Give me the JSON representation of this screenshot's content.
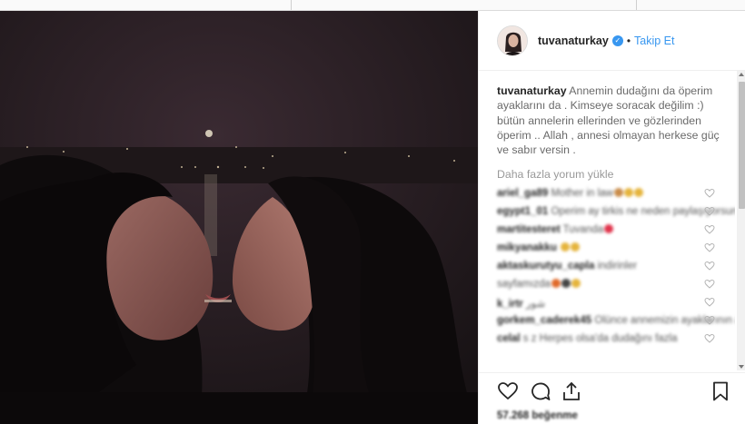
{
  "post": {
    "username": "tuvanaturkay",
    "dot": "•",
    "follow_label": "Takip Et",
    "caption": "Annemin dudağını da öperim ayaklarını da . Kimseye soracak değilim :) bütün annelerin ellerinden ve gözlerinden öperim .. Allah , annesi olmayan herkese güç ve sabır versin .",
    "load_more": "Daha fazla yorum yükle",
    "likes": "57.268 beğenme"
  },
  "comments": [
    {
      "user": "ariel_ga89",
      "text": "Mother in law",
      "emoji": [
        "#c98c4a",
        "#e5b43c",
        "#e5b43c"
      ]
    },
    {
      "user": "egypt1_01",
      "text": "Öperim ay tirkis ne neden paylaşıyorsun",
      "emoji": []
    },
    {
      "user": "martitesteret",
      "text": "Tuvanda",
      "emoji": [
        "#e0334b"
      ]
    },
    {
      "user": "mikyanakku",
      "text": "",
      "emoji": [
        "#e5b43c",
        "#e5b43c"
      ]
    },
    {
      "user": "aktaskurutyu_capla",
      "text": "indirinler",
      "emoji": []
    },
    {
      "user": "",
      "text": "sayfamızda",
      "emoji": [
        "#e06a2a",
        "#444",
        "#e5b43c"
      ]
    },
    {
      "user": "k_irtr",
      "text": "شور",
      "emoji": []
    },
    {
      "user": "gorkem_caderek45",
      "text": "Ölünce annemizin ayaklarının altına girmen yeter",
      "emoji": []
    },
    {
      "user": "celal",
      "text": "s z Herpes olsa'da dudağını fazla",
      "emoji": []
    }
  ],
  "colors": {
    "link": "#3897f0",
    "text": "#262626",
    "muted": "#999999"
  },
  "icons": {
    "like": "heart-outline-icon",
    "comment": "speech-bubble-icon",
    "share": "share-upload-icon",
    "save": "bookmark-icon",
    "verified": "verified-badge-icon"
  }
}
